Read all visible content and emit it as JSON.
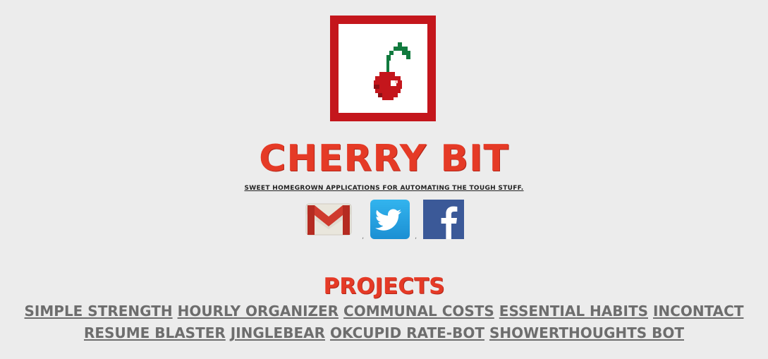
{
  "header": {
    "title": "Cherry Bit",
    "tagline": "Sweet homegrown applications for automating the tough stuff."
  },
  "social": [
    {
      "name": "gmail-icon"
    },
    {
      "name": "twitter-icon"
    },
    {
      "name": "facebook-icon"
    }
  ],
  "projects": {
    "title": "Projects",
    "items": [
      "Simple Strength",
      "Hourly Organizer",
      "Communal Costs",
      "Essential Habits",
      "InContact",
      "Resume Blaster",
      "JingleBear",
      "OkCupid Rate-Bot",
      "ShowerThoughts Bot"
    ]
  },
  "colors": {
    "accent": "#e53a26",
    "logo_frame": "#c4161c",
    "background": "#ececec",
    "link": "#6d6d6d"
  }
}
